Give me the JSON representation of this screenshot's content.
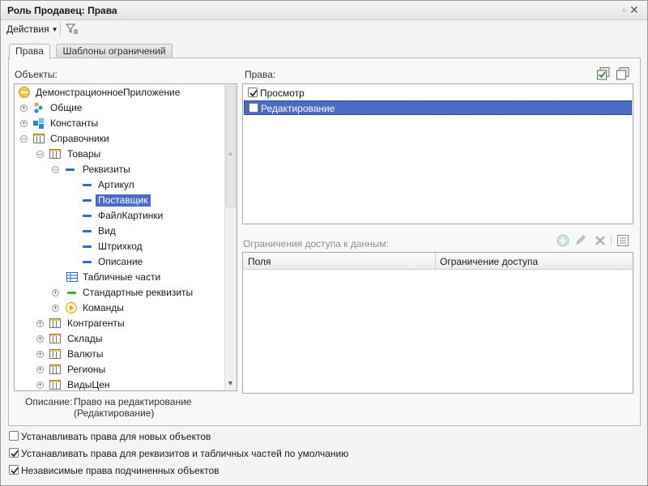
{
  "window": {
    "title": "Роль Продавец: Права"
  },
  "toolbar": {
    "actions_label": "Действия"
  },
  "tabs": [
    {
      "label": "Права",
      "active": true
    },
    {
      "label": "Шаблоны ограничений",
      "active": false
    }
  ],
  "objects_panel": {
    "label": "Объекты:"
  },
  "tree": {
    "root": "ДемонстрационноеПриложение",
    "obshie": "Общие",
    "konstanty": "Константы",
    "spravochniki": "Справочники",
    "tovary": "Товары",
    "rekvizity": "Реквизиты",
    "artikul": "Артикул",
    "postavshik": "Поставщик",
    "faylkartinki": "ФайлКартинки",
    "vid": "Вид",
    "shtrikhkod": "Штрихкод",
    "opisanie": "Описание",
    "tabl_chasti": "Табличные части",
    "std_rekvizity": "Стандартные реквизиты",
    "komandy": "Команды",
    "kontragenty": "Контрагенты",
    "sklady": "Склады",
    "valyuty": "Валюты",
    "regiony": "Регионы",
    "vidytsen": "ВидыЦен",
    "selected": "Поставщик"
  },
  "rights_panel": {
    "label": "Права:",
    "items": [
      {
        "label": "Просмотр",
        "checked": true
      },
      {
        "label": "Редактирование",
        "checked": false,
        "selected": true
      }
    ]
  },
  "restrictions": {
    "label": "Ограничения доступа к данным:",
    "columns": [
      "Поля",
      "Ограничение доступа"
    ]
  },
  "description": {
    "label": "Описание:",
    "line1": "Право на редактирование",
    "line2": "(Редактирование)"
  },
  "options": [
    {
      "label": "Устанавливать права для новых объектов",
      "checked": false
    },
    {
      "label": "Устанавливать права для реквизитов и табличных частей по умолчанию",
      "checked": true
    },
    {
      "label": "Независимые права подчиненных объектов",
      "checked": true
    }
  ],
  "colors": {
    "selection": "#4b6bc4",
    "accent_green": "#4caf50"
  }
}
